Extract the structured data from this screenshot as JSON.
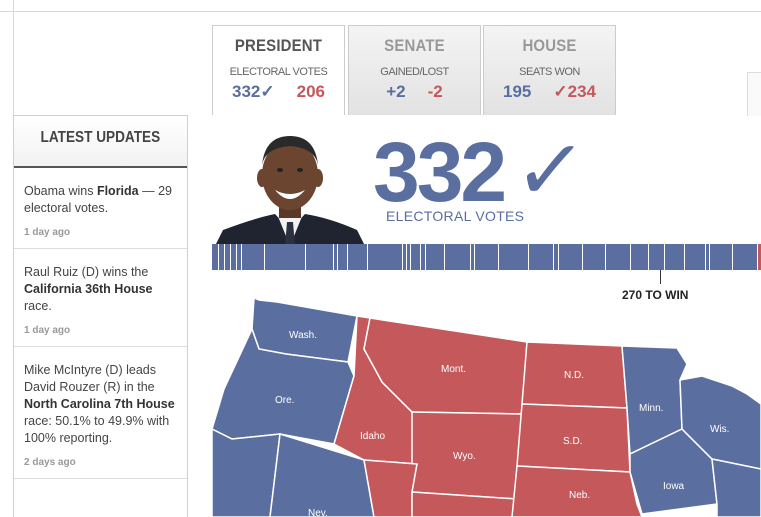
{
  "tabs": [
    {
      "title": "PRESIDENT",
      "subtitle": "ELECTORAL VOTES",
      "blue": "332",
      "blue_check": "✓",
      "red": "206",
      "red_check": ""
    },
    {
      "title": "SENATE",
      "subtitle": "GAINED/LOST",
      "blue": "+2",
      "blue_check": "",
      "red": "-2",
      "red_check": ""
    },
    {
      "title": "HOUSE",
      "subtitle": "SEATS WON",
      "blue": "195",
      "blue_check": "",
      "red": "234",
      "red_check": "✓"
    }
  ],
  "sidebar": {
    "title": "LATEST UPDATES",
    "updates": [
      {
        "pre": "Obama wins ",
        "bold": "Florida",
        "post": " — 29 electoral votes.",
        "ago": "1 day ago"
      },
      {
        "pre": "Raul Ruiz (D) wins the ",
        "bold": "California 36th House",
        "post": " race.",
        "ago": "1 day ago"
      },
      {
        "pre": "Mike McIntyre (D) leads David Rouzer (R) in the ",
        "bold": "North Carolina 7th House",
        "post": " race: 50.1% to 49.9% with 100% reporting.",
        "ago": "2 days ago"
      }
    ]
  },
  "headline": {
    "number": "332",
    "check": "✓",
    "label": "ELECTORAL VOTES"
  },
  "win_label": "270 TO WIN",
  "map": {
    "states": [
      "Wash.",
      "Ore.",
      "Idaho",
      "Mont.",
      "Wyo.",
      "N.D.",
      "S.D.",
      "Neb.",
      "Minn.",
      "Iowa",
      "Wis.",
      "Nev."
    ]
  },
  "colors": {
    "democrat": "#5a6fa0",
    "republican": "#c4585a"
  },
  "icons": {
    "portrait": "candidate-portrait"
  }
}
